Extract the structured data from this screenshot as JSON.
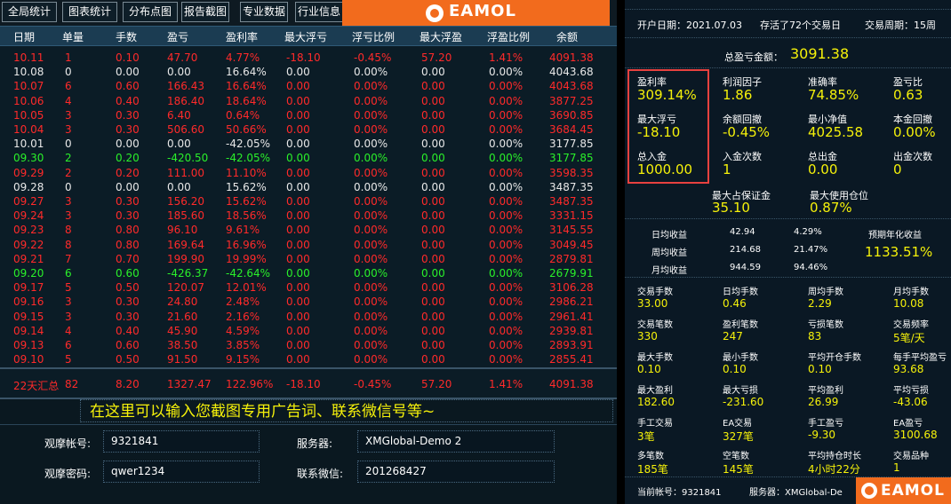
{
  "toolbar": {
    "buttons": [
      "全局统计",
      "图表统计",
      "分布点图",
      "报告截图",
      "专业数据",
      "行业信息"
    ]
  },
  "brand": {
    "name": "EAMOL"
  },
  "table": {
    "headers": [
      "日期",
      "单量",
      "手数",
      "盈亏",
      "盈利率",
      "最大浮亏",
      "浮亏比例",
      "最大浮盈",
      "浮盈比例",
      "余额"
    ],
    "rows": [
      {
        "cells": [
          "10.11",
          "1",
          "0.10",
          "47.70",
          "4.77%",
          "-18.10",
          "-0.45%",
          "57.20",
          "1.41%",
          "4091.38"
        ],
        "tone": "red"
      },
      {
        "cells": [
          "10.08",
          "0",
          "0.00",
          "0.00",
          "16.64%",
          "0.00",
          "0.00%",
          "0.00",
          "0.00%",
          "4043.68"
        ],
        "tone": "white"
      },
      {
        "cells": [
          "10.07",
          "6",
          "0.60",
          "166.43",
          "16.64%",
          "0.00",
          "0.00%",
          "0.00",
          "0.00%",
          "4043.68"
        ],
        "tone": "red"
      },
      {
        "cells": [
          "10.06",
          "4",
          "0.40",
          "186.40",
          "18.64%",
          "0.00",
          "0.00%",
          "0.00",
          "0.00%",
          "3877.25"
        ],
        "tone": "red"
      },
      {
        "cells": [
          "10.05",
          "3",
          "0.30",
          "6.40",
          "0.64%",
          "0.00",
          "0.00%",
          "0.00",
          "0.00%",
          "3690.85"
        ],
        "tone": "red"
      },
      {
        "cells": [
          "10.04",
          "3",
          "0.30",
          "506.60",
          "50.66%",
          "0.00",
          "0.00%",
          "0.00",
          "0.00%",
          "3684.45"
        ],
        "tone": "red"
      },
      {
        "cells": [
          "10.01",
          "0",
          "0.00",
          "0.00",
          "-42.05%",
          "0.00",
          "0.00%",
          "0.00",
          "0.00%",
          "3177.85"
        ],
        "tone": "white"
      },
      {
        "cells": [
          "09.30",
          "2",
          "0.20",
          "-420.50",
          "-42.05%",
          "0.00",
          "0.00%",
          "0.00",
          "0.00%",
          "3177.85"
        ],
        "tone": "green"
      },
      {
        "cells": [
          "09.29",
          "2",
          "0.20",
          "111.00",
          "11.10%",
          "0.00",
          "0.00%",
          "0.00",
          "0.00%",
          "3598.35"
        ],
        "tone": "red"
      },
      {
        "cells": [
          "09.28",
          "0",
          "0.00",
          "0.00",
          "15.62%",
          "0.00",
          "0.00%",
          "0.00",
          "0.00%",
          "3487.35"
        ],
        "tone": "white"
      },
      {
        "cells": [
          "09.27",
          "3",
          "0.30",
          "156.20",
          "15.62%",
          "0.00",
          "0.00%",
          "0.00",
          "0.00%",
          "3487.35"
        ],
        "tone": "red"
      },
      {
        "cells": [
          "09.24",
          "3",
          "0.30",
          "185.60",
          "18.56%",
          "0.00",
          "0.00%",
          "0.00",
          "0.00%",
          "3331.15"
        ],
        "tone": "red"
      },
      {
        "cells": [
          "09.23",
          "8",
          "0.80",
          "96.10",
          "9.61%",
          "0.00",
          "0.00%",
          "0.00",
          "0.00%",
          "3145.55"
        ],
        "tone": "red"
      },
      {
        "cells": [
          "09.22",
          "8",
          "0.80",
          "169.64",
          "16.96%",
          "0.00",
          "0.00%",
          "0.00",
          "0.00%",
          "3049.45"
        ],
        "tone": "red"
      },
      {
        "cells": [
          "09.21",
          "7",
          "0.70",
          "199.90",
          "19.99%",
          "0.00",
          "0.00%",
          "0.00",
          "0.00%",
          "2879.81"
        ],
        "tone": "red"
      },
      {
        "cells": [
          "09.20",
          "6",
          "0.60",
          "-426.37",
          "-42.64%",
          "0.00",
          "0.00%",
          "0.00",
          "0.00%",
          "2679.91"
        ],
        "tone": "green"
      },
      {
        "cells": [
          "09.17",
          "5",
          "0.50",
          "120.07",
          "12.01%",
          "0.00",
          "0.00%",
          "0.00",
          "0.00%",
          "3106.28"
        ],
        "tone": "red"
      },
      {
        "cells": [
          "09.16",
          "3",
          "0.30",
          "24.80",
          "2.48%",
          "0.00",
          "0.00%",
          "0.00",
          "0.00%",
          "2986.21"
        ],
        "tone": "red"
      },
      {
        "cells": [
          "09.15",
          "3",
          "0.30",
          "21.60",
          "2.16%",
          "0.00",
          "0.00%",
          "0.00",
          "0.00%",
          "2961.41"
        ],
        "tone": "red"
      },
      {
        "cells": [
          "09.14",
          "4",
          "0.40",
          "45.90",
          "4.59%",
          "0.00",
          "0.00%",
          "0.00",
          "0.00%",
          "2939.81"
        ],
        "tone": "red"
      },
      {
        "cells": [
          "09.13",
          "6",
          "0.60",
          "38.50",
          "3.85%",
          "0.00",
          "0.00%",
          "0.00",
          "0.00%",
          "2893.91"
        ],
        "tone": "red"
      },
      {
        "cells": [
          "09.10",
          "5",
          "0.50",
          "91.50",
          "9.15%",
          "0.00",
          "0.00%",
          "0.00",
          "0.00%",
          "2855.41"
        ],
        "tone": "red"
      }
    ],
    "summary": [
      "22天汇总",
      "82",
      "8.20",
      "1327.47",
      "122.96%",
      "-18.10",
      "-0.45%",
      "57.20",
      "1.41%",
      "4091.38"
    ]
  },
  "ad_text": "在这里可以输入您截图专用广告词、联系微信号等~",
  "account": {
    "view_account_label": "观摩帐号:",
    "view_account_value": "9321841",
    "view_password_label": "观摩密码:",
    "view_password_value": "qwer1234",
    "server_label": "服务器:",
    "server_value": "XMGlobal-Demo 2",
    "wechat_label": "联系微信:",
    "wechat_value": "201268427"
  },
  "panel": {
    "open_date": "开户日期：2021.07.03",
    "survived": "存活了72个交易日",
    "cycle": "交易周期：15周",
    "total_pnl_label": "总盈亏金额：",
    "total_pnl_value": "3091.38",
    "stats": [
      {
        "label": "盈利率",
        "value": "309.14%"
      },
      {
        "label": "利润因子",
        "value": "1.86"
      },
      {
        "label": "准确率",
        "value": "74.85%"
      },
      {
        "label": "盈亏比",
        "value": "0.63"
      },
      {
        "label": "最大浮亏",
        "value": "-18.10"
      },
      {
        "label": "余额回撤",
        "value": "-0.45%"
      },
      {
        "label": "最小净值",
        "value": "4025.58"
      },
      {
        "label": "本金回撤",
        "value": "0.00%"
      },
      {
        "label": "总入金",
        "value": "1000.00"
      },
      {
        "label": "入金次数",
        "value": "1"
      },
      {
        "label": "总出金",
        "value": "0.00"
      },
      {
        "label": "出金次数",
        "value": "0"
      }
    ],
    "margin": [
      {
        "label": "最大占保证金",
        "value": "35.10"
      },
      {
        "label": "最大使用仓位",
        "value": "0.87%"
      }
    ],
    "returns": [
      {
        "label": "日均收益",
        "amount": "42.94",
        "pct": "4.29%"
      },
      {
        "label": "周均收益",
        "amount": "214.68",
        "pct": "21.47%"
      },
      {
        "label": "月均收益",
        "amount": "944.59",
        "pct": "94.46%"
      }
    ],
    "annual_label": "预期年化收益",
    "annual_value": "1133.51%",
    "grid": [
      {
        "label": "交易手数",
        "value": "33.00"
      },
      {
        "label": "日均手数",
        "value": "0.46"
      },
      {
        "label": "周均手数",
        "value": "2.29"
      },
      {
        "label": "月均手数",
        "value": "10.08"
      },
      {
        "label": "交易笔数",
        "value": "330"
      },
      {
        "label": "盈利笔数",
        "value": "247"
      },
      {
        "label": "亏损笔数",
        "value": "83"
      },
      {
        "label": "交易频率",
        "value": "5笔/天"
      },
      {
        "label": "最大手数",
        "value": "0.10"
      },
      {
        "label": "最小手数",
        "value": "0.10"
      },
      {
        "label": "平均开仓手数",
        "value": "0.10"
      },
      {
        "label": "每手平均盈亏",
        "value": "93.68"
      },
      {
        "label": "最大盈利",
        "value": "182.60"
      },
      {
        "label": "最大亏损",
        "value": "-231.60"
      },
      {
        "label": "平均盈利",
        "value": "26.99"
      },
      {
        "label": "平均亏损",
        "value": "-43.06"
      },
      {
        "label": "手工交易",
        "value": "3笔"
      },
      {
        "label": "EA交易",
        "value": "327笔"
      },
      {
        "label": "手工盈亏",
        "value": "-9.30"
      },
      {
        "label": "EA盈亏",
        "value": "3100.68"
      },
      {
        "label": "多笔数",
        "value": "185笔"
      },
      {
        "label": "空笔数",
        "value": "145笔"
      },
      {
        "label": "平均持仓时长",
        "value": "4小时22分"
      },
      {
        "label": "交易品种",
        "value": "1"
      }
    ],
    "current_account": "当前帐号：9321841",
    "current_server": "服务器：XMGlobal-De"
  },
  "colors": {
    "orange": "#f26b1d",
    "yellow": "#f5f10a",
    "red": "#ff2a2a",
    "green": "#2af02a",
    "highlight": "#e8413f"
  }
}
